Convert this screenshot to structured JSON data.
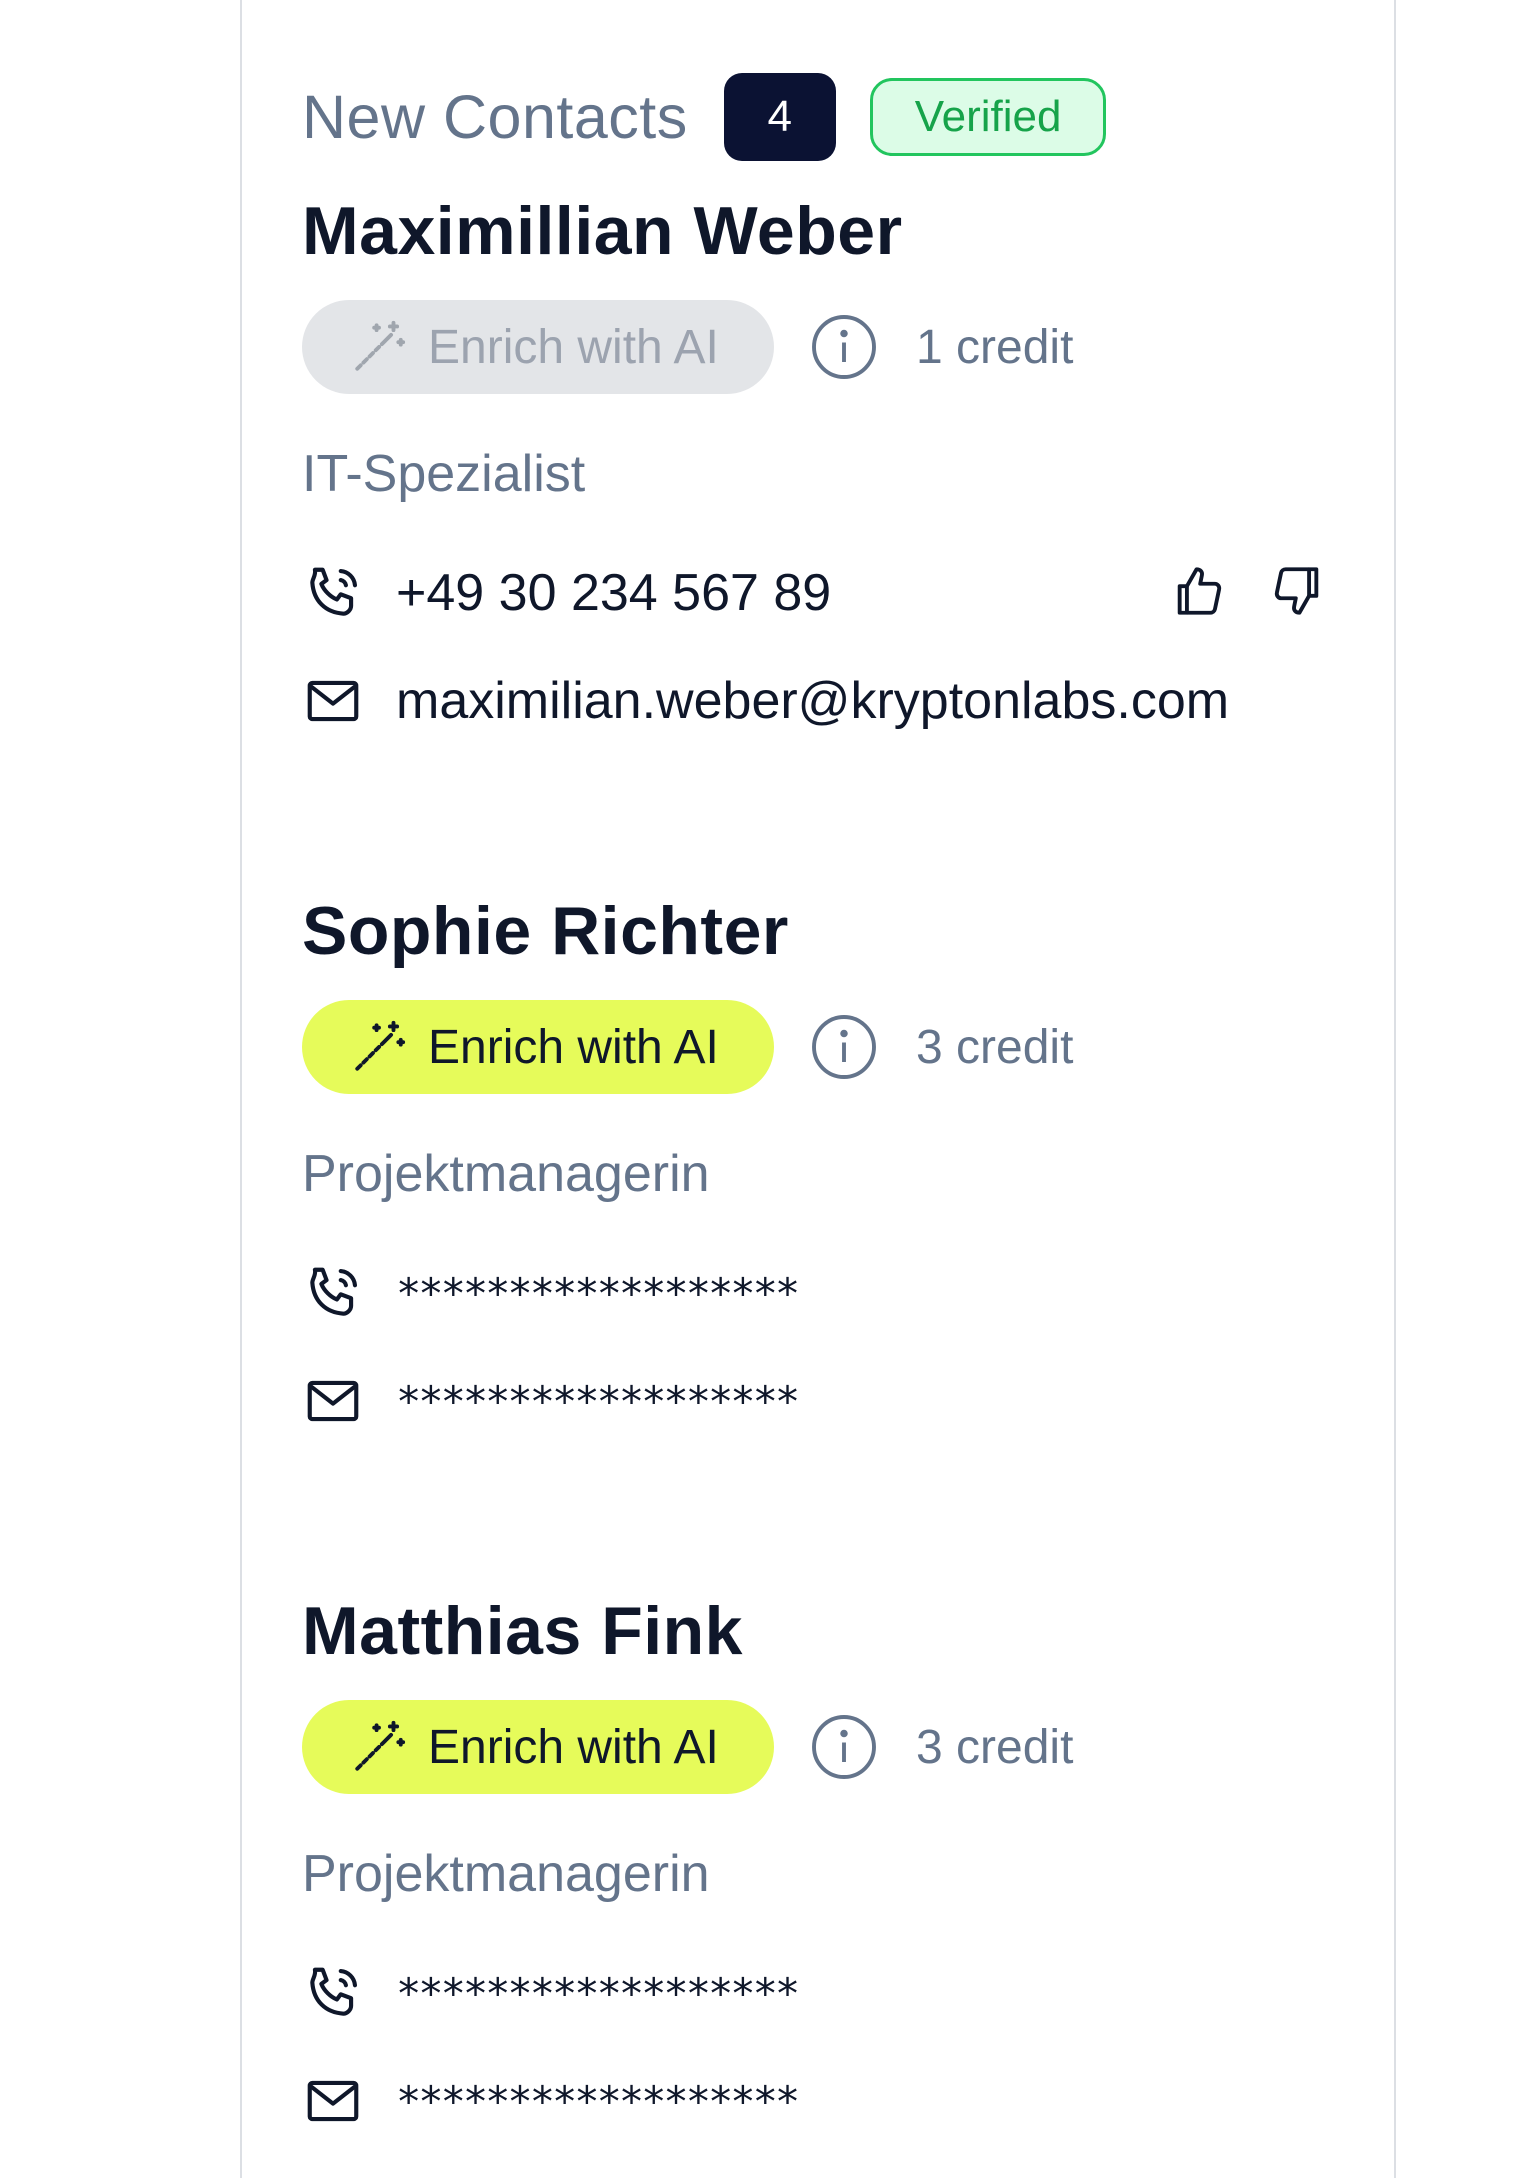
{
  "header": {
    "title": "New Contacts",
    "count": "4",
    "verified_label": "Verified"
  },
  "contacts": [
    {
      "name": "Maximillian Weber",
      "enrich_label": "Enrich with AI",
      "enrich_state": "disabled",
      "credit": "1 credit",
      "role": "IT-Spezialist",
      "phone": "+49 30 234 567 89",
      "email": "maximilian.weber@kryptonlabs.com"
    },
    {
      "name": "Sophie Richter",
      "enrich_label": "Enrich with AI",
      "enrich_state": "active",
      "credit": "3 credit",
      "role": "Projektmanagerin",
      "phone": "******************",
      "email": "******************"
    },
    {
      "name": "Matthias Fink",
      "enrich_label": "Enrich with AI",
      "enrich_state": "active",
      "credit": "3 credit",
      "role": "Projektmanagerin",
      "phone": "******************",
      "email": "******************"
    }
  ],
  "icons": {
    "enrich": "magic-wand-icon",
    "info": "info-icon",
    "phone": "phone-icon",
    "email": "mail-icon",
    "like": "thumbs-up-icon",
    "dislike": "thumbs-down-icon"
  },
  "colors": {
    "accent": "#e6fb5a",
    "badge_dark": "#0b1233",
    "verified_bg": "#dcfce7",
    "verified_text": "#16a34a",
    "muted": "#64748b"
  }
}
